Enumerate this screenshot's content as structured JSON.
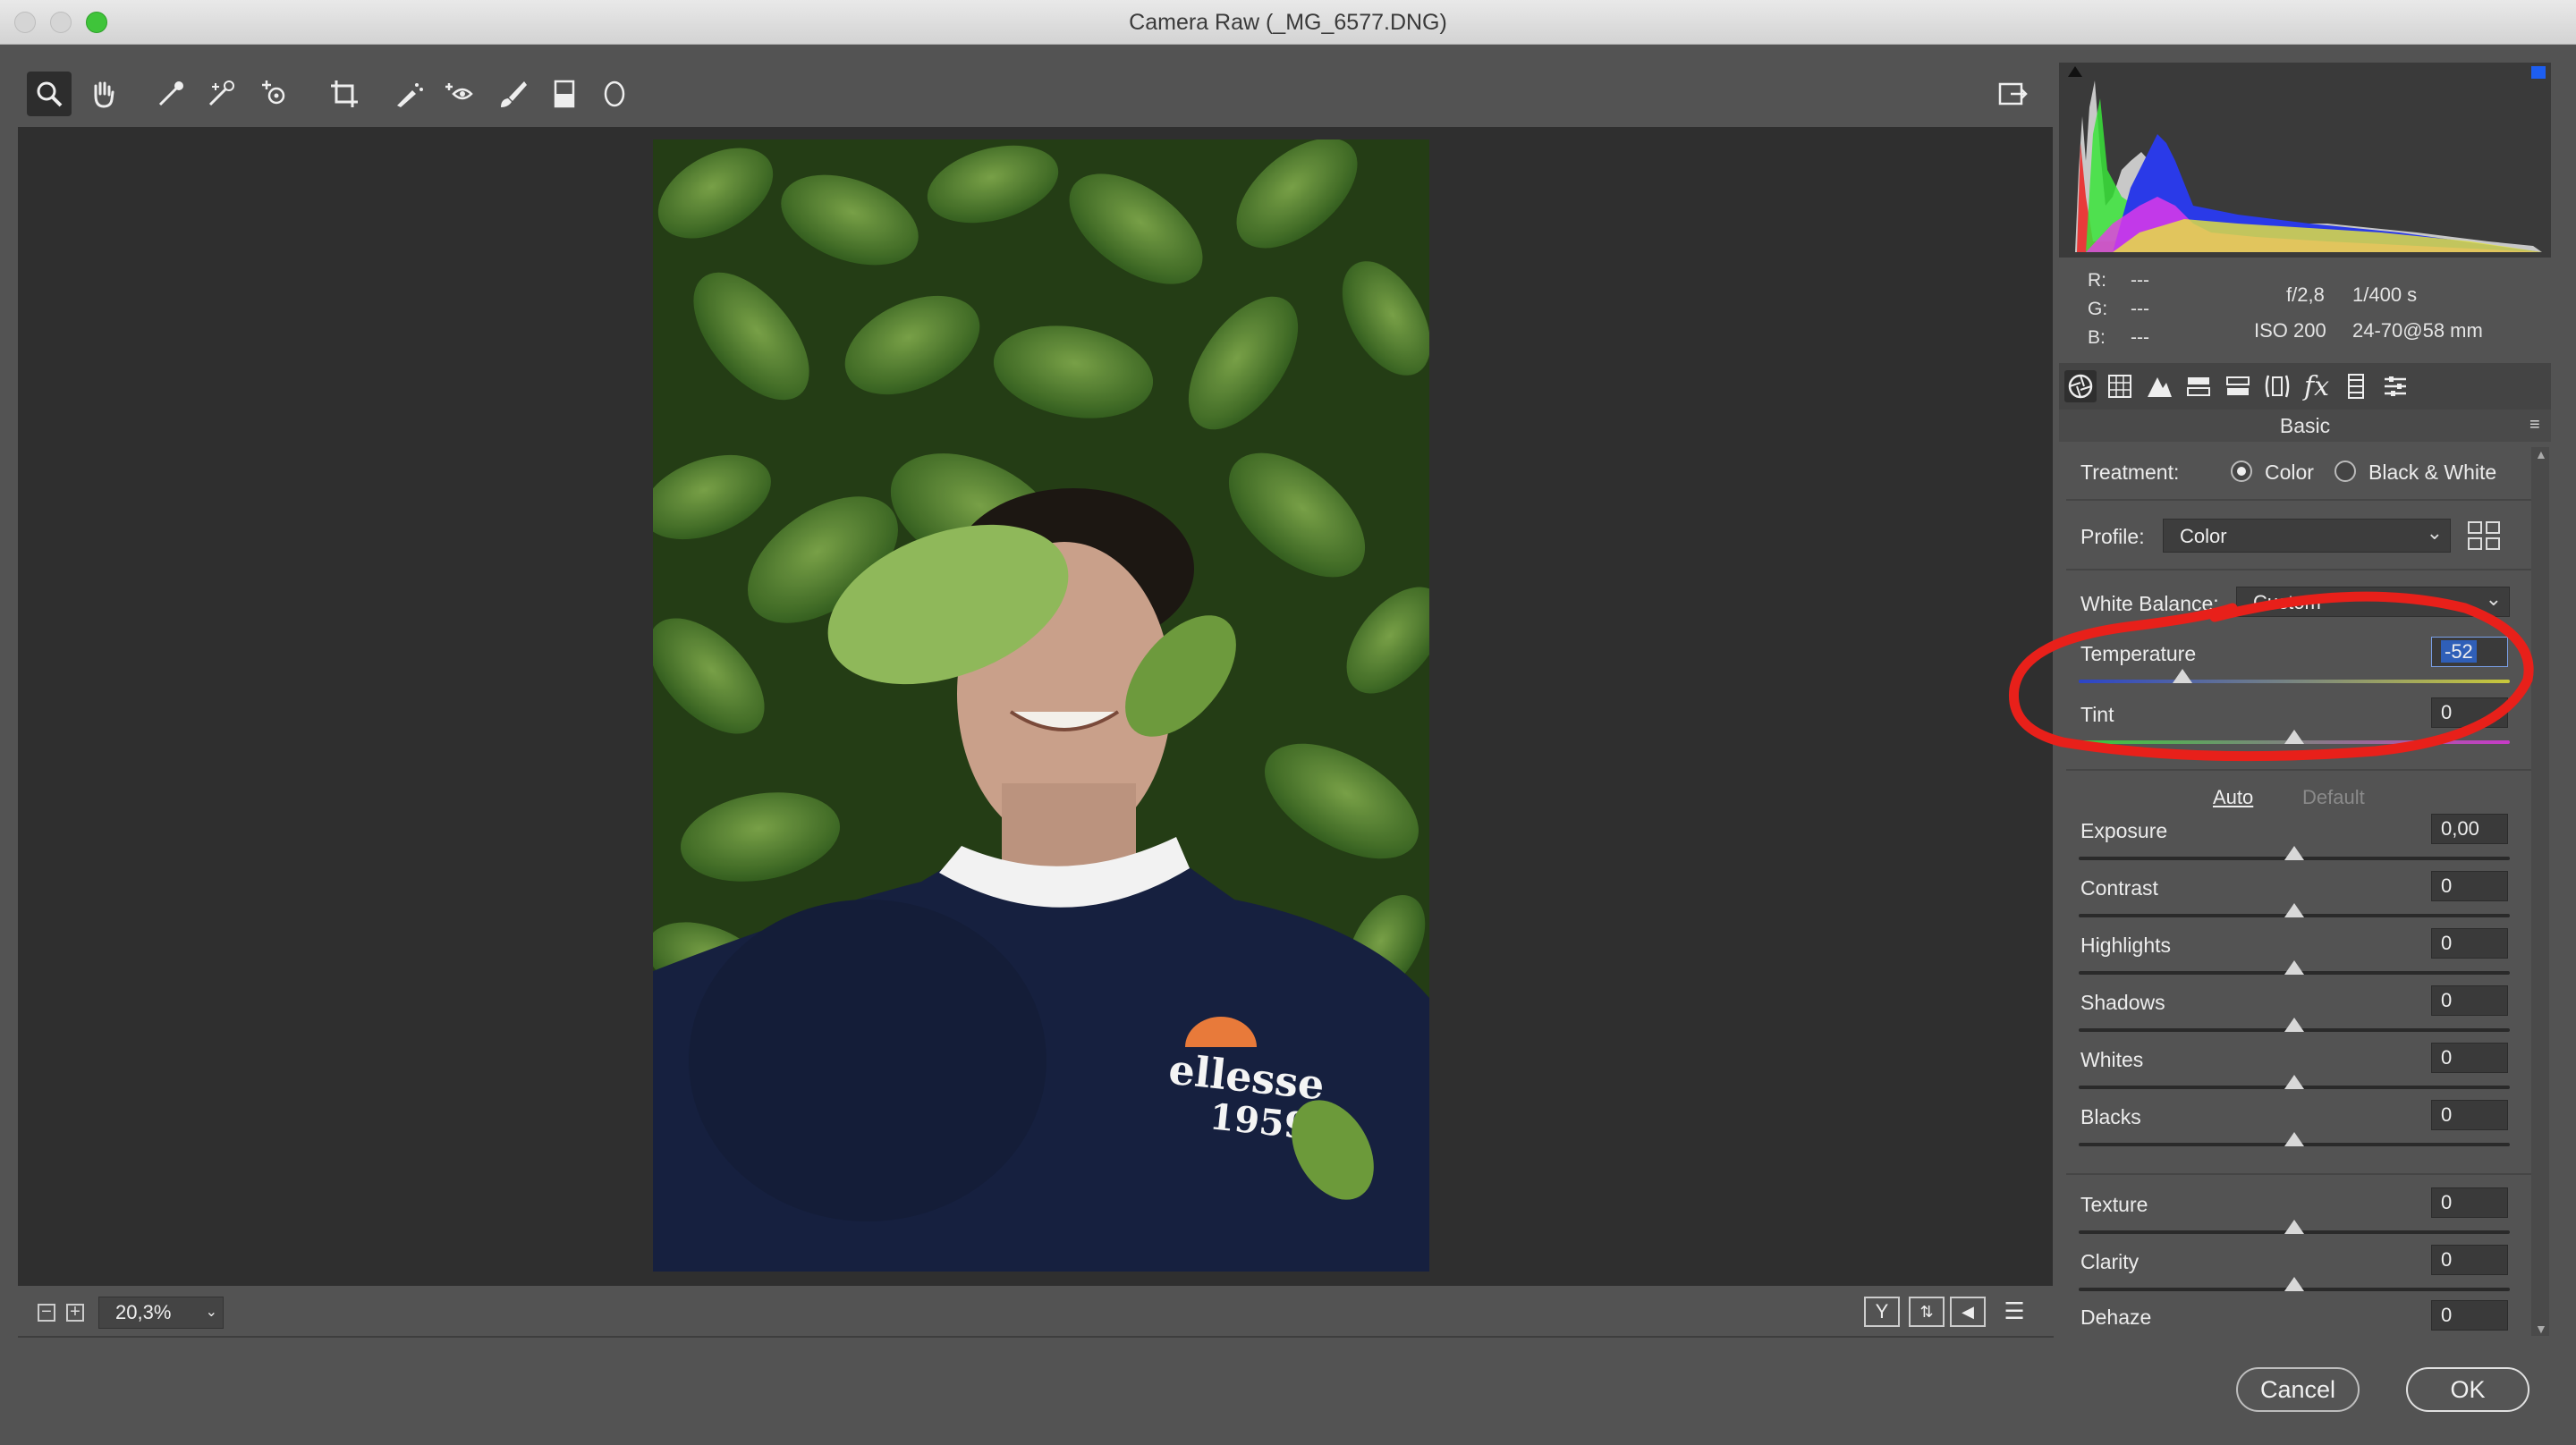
{
  "window": {
    "title": "Camera Raw (_MG_6577.DNG)"
  },
  "toolbar": {
    "tools": [
      "zoom-icon",
      "hand-icon",
      "white-balance-icon",
      "color-sampler-icon",
      "targeted-adjust-icon",
      "crop-icon",
      "spot-removal-icon",
      "red-eye-icon",
      "adjustment-brush-icon",
      "graduated-filter-icon",
      "radial-filter-icon"
    ],
    "export_icon": "open-preferences-icon"
  },
  "zoom": {
    "value": "20,3%"
  },
  "histogram": {
    "r_label": "R:",
    "r_value": "---",
    "g_label": "G:",
    "g_value": "---",
    "b_label": "B:",
    "b_value": "---",
    "aperture": "f/2,8",
    "shutter": "1/400 s",
    "iso": "ISO 200",
    "lens": "24-70@58 mm"
  },
  "panel": {
    "title": "Basic",
    "treatment_label": "Treatment:",
    "treatment_color": "Color",
    "treatment_bw": "Black & White",
    "profile_label": "Profile:",
    "profile_value": "Color",
    "white_balance_label": "White Balance:",
    "white_balance_value": "Custom",
    "auto_link": "Auto",
    "default_link": "Default",
    "sliders": [
      {
        "label": "Temperature",
        "value": "-52",
        "level": 0.24
      },
      {
        "label": "Tint",
        "value": "0",
        "level": 0.5
      },
      {
        "label": "Exposure",
        "value": "0,00",
        "level": 0.5
      },
      {
        "label": "Contrast",
        "value": "0",
        "level": 0.5
      },
      {
        "label": "Highlights",
        "value": "0",
        "level": 0.5
      },
      {
        "label": "Shadows",
        "value": "0",
        "level": 0.5
      },
      {
        "label": "Whites",
        "value": "0",
        "level": 0.5
      },
      {
        "label": "Blacks",
        "value": "0",
        "level": 0.5
      },
      {
        "label": "Texture",
        "value": "0",
        "level": 0.5
      },
      {
        "label": "Clarity",
        "value": "0",
        "level": 0.5
      },
      {
        "label": "Dehaze",
        "value": "0",
        "level": 0.5
      }
    ]
  },
  "buttons": {
    "cancel": "Cancel",
    "ok": "OK"
  },
  "colors": {
    "annotation": "#e8201a",
    "selection": "#2f5fb8"
  }
}
